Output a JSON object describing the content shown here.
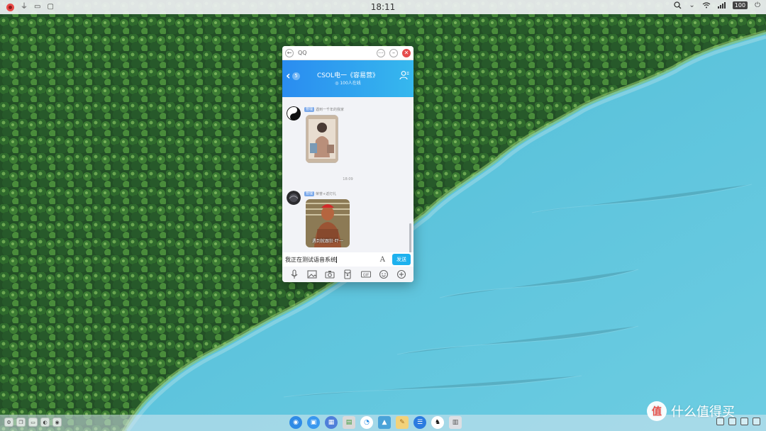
{
  "statusbar": {
    "time": "18:11",
    "battery": "100",
    "icons": [
      "close-dot-icon",
      "usb-icon",
      "cast-icon",
      "display-icon",
      "search-icon",
      "collapse-icon",
      "wifi-icon",
      "signal-icon",
      "battery-icon",
      "power-icon"
    ]
  },
  "window": {
    "title": "QQ",
    "controls": [
      "back-icon",
      "more-icon",
      "minimize-icon",
      "close-icon"
    ]
  },
  "chat_header": {
    "back_count": "5",
    "group_name": "CSOL电一《容易营》",
    "online": "◎ 100人在线"
  },
  "messages": [
    {
      "badge": "管理",
      "sender": "遇到一千年的我家",
      "avatar": "yin-yang-avatar",
      "content": "image"
    },
    {
      "badge": "管理",
      "sender": "荣誉+返灯礼",
      "avatar": "dark-avatar",
      "content": "image",
      "image_caption": "遇到就跟狂·吓一"
    }
  ],
  "timestamp": "18:09",
  "input": {
    "value": "我正在测试语音系统",
    "font_button": "A",
    "send_label": "发送"
  },
  "toolbar": [
    "mic-icon",
    "image-icon",
    "camera-icon",
    "red-packet-icon",
    "gif-icon",
    "emoji-icon",
    "plus-icon"
  ],
  "dock": {
    "apps": [
      "launcher-icon",
      "multitask-icon",
      "files-icon",
      "system-monitor-icon",
      "browser-icon",
      "photos-icon",
      "notes-icon",
      "chat-icon",
      "qq-icon",
      "trash-icon"
    ]
  },
  "watermark": {
    "badge": "值",
    "text": "什么值得买"
  },
  "colors": {
    "header_start": "#2a8cf0",
    "header_end": "#36b8ee",
    "send": "#1eb1ee",
    "close": "#e64c4c"
  }
}
